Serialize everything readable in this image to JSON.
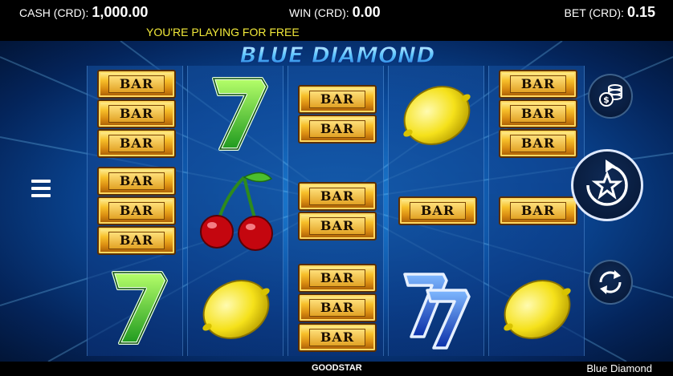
{
  "header": {
    "cash_label": "CASH (CRD):",
    "cash_value": "1,000.00",
    "win_label": "WIN (CRD):",
    "win_value": "0.00",
    "bet_label": "BET (CRD):",
    "bet_value": "0.15"
  },
  "banner": {
    "free_play_message": "YOU'RE PLAYING FOR FREE"
  },
  "game": {
    "logo_text": "BLUE DIAMOND"
  },
  "reels": [
    {
      "symbols": [
        "bar-3",
        "bar-3",
        "seven-green"
      ]
    },
    {
      "symbols": [
        "seven-green",
        "cherries",
        "lemon"
      ]
    },
    {
      "symbols": [
        "bar-2",
        "bar-2",
        "bar-3"
      ]
    },
    {
      "symbols": [
        "lemon",
        "bar-1",
        "seven-blue-double"
      ]
    },
    {
      "symbols": [
        "bar-3",
        "bar-1",
        "lemon"
      ]
    }
  ],
  "symbol_text": {
    "bar": "BAR"
  },
  "controls": {
    "menu_icon": "hamburger-menu-icon",
    "bet_icon": "coin-stack-icon",
    "spin_icon": "star-spin-icon",
    "autoplay_icon": "refresh-arrows-icon"
  },
  "footer": {
    "brand": "GOODSTAR",
    "game_name": "Blue Diamond"
  },
  "colors": {
    "banner_text": "#f3ea3a",
    "background": "#0b4b9c",
    "bar_gold": "#f7c02a"
  }
}
